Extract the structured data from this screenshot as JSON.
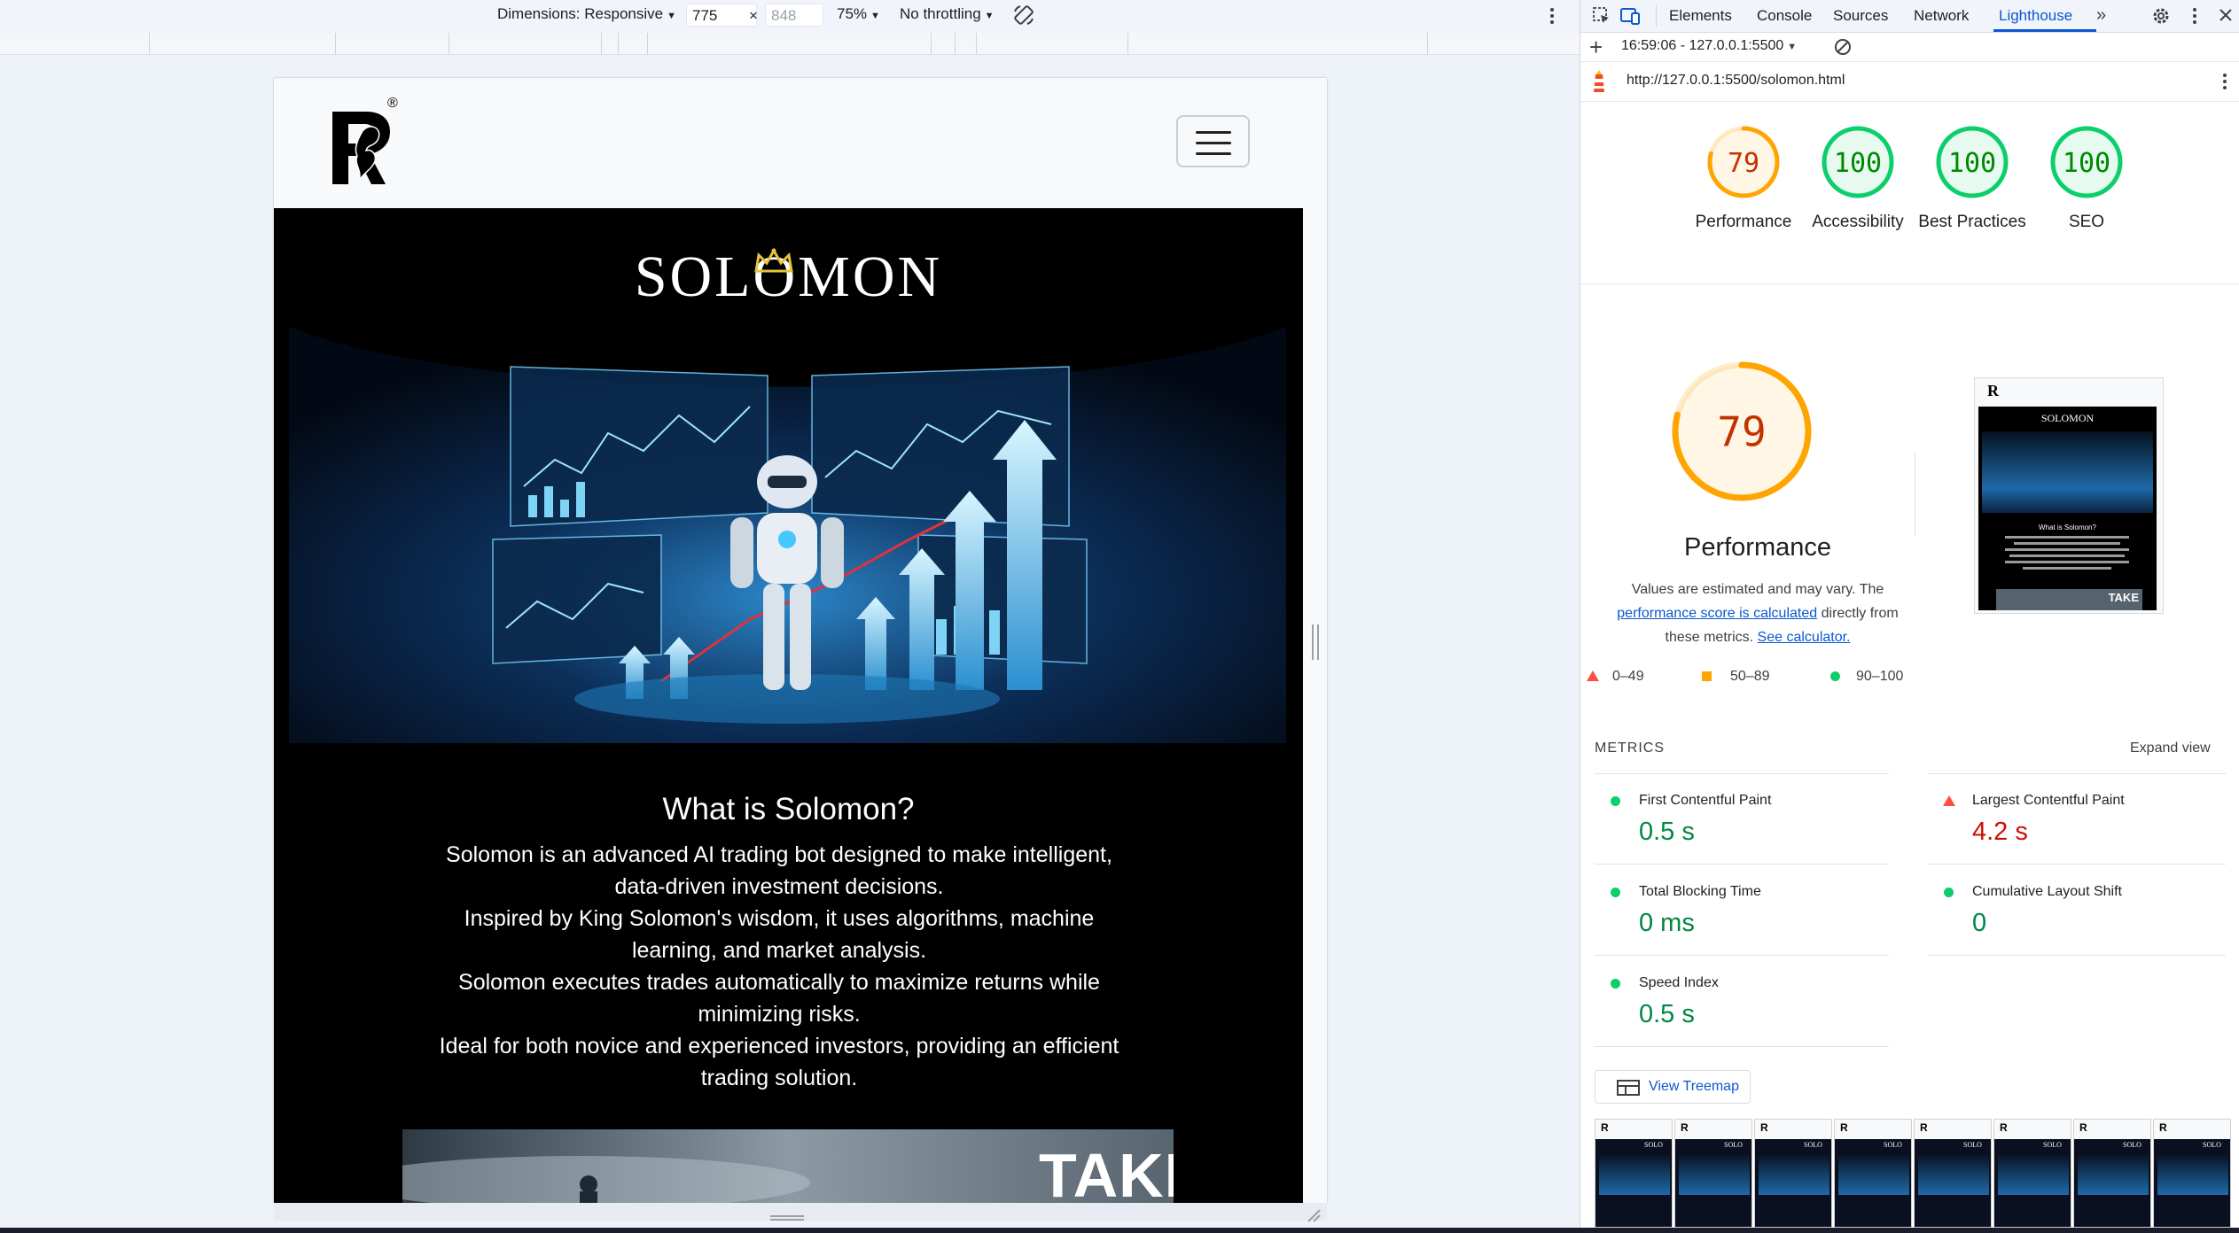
{
  "device_toolbar": {
    "dimensions_label": "Dimensions: Responsive",
    "width_value": "775",
    "times": "×",
    "height_placeholder": "848",
    "zoom": "75%",
    "throttling": "No throttling"
  },
  "site": {
    "logo_text": "R",
    "logo_registered": "®",
    "brand_name": "SOLOMON",
    "section_title": "What is Solomon?",
    "paragraphs": [
      "Solomon is an advanced AI trading bot designed to make intelligent, data-driven investment decisions.",
      "Inspired by King Solomon's wisdom, it uses algorithms, machine learning, and market analysis.",
      "Solomon executes trades automatically to maximize returns while minimizing risks.",
      "Ideal for both novice and experienced investors, providing an efficient trading solution."
    ],
    "promo_text": "TAKE"
  },
  "devtools": {
    "tabs": [
      "Elements",
      "Console",
      "Sources",
      "Network",
      "Lighthouse"
    ],
    "active_tab": "Lighthouse",
    "more_tabs_icon": "chevron-double-right-icon",
    "report_selector": "16:59:06 - 127.0.0.1:5500",
    "url": "http://127.0.0.1:5500/solomon.html",
    "scores": [
      {
        "label": "Performance",
        "value": 79,
        "color": "#ffa400"
      },
      {
        "label": "Accessibility",
        "value": 100,
        "color": "#0cce6b"
      },
      {
        "label": "Best Practices",
        "value": 100,
        "color": "#0cce6b"
      },
      {
        "label": "SEO",
        "value": 100,
        "color": "#0cce6b"
      }
    ],
    "performance": {
      "score": "79",
      "title": "Performance",
      "desc_1": "Values are estimated and may vary. The",
      "link_1": "performance score is calculated",
      "desc_2": "directly from",
      "desc_3": "these metrics.",
      "link_2": "See calculator."
    },
    "legend": {
      "fail": "0–49",
      "average": "50–89",
      "pass": "90–100"
    },
    "metrics_heading": "METRICS",
    "expand_view": "Expand view",
    "metrics": [
      {
        "title": "First Contentful Paint",
        "value": "0.5 s",
        "status": "pass"
      },
      {
        "title": "Largest Contentful Paint",
        "value": "4.2 s",
        "status": "fail"
      },
      {
        "title": "Total Blocking Time",
        "value": "0 ms",
        "status": "pass"
      },
      {
        "title": "Cumulative Layout Shift",
        "value": "0",
        "status": "pass"
      },
      {
        "title": "Speed Index",
        "value": "0.5 s",
        "status": "pass"
      }
    ],
    "view_treemap": "View Treemap",
    "screenshot_preview": {
      "brand": "SOLOMON",
      "title": "What is Solomon?",
      "promo": "TAKE"
    }
  },
  "colors": {
    "pass": "#0cce6b",
    "average": "#ffa400",
    "fail": "#ff4e42",
    "link": "#0b57d0"
  }
}
